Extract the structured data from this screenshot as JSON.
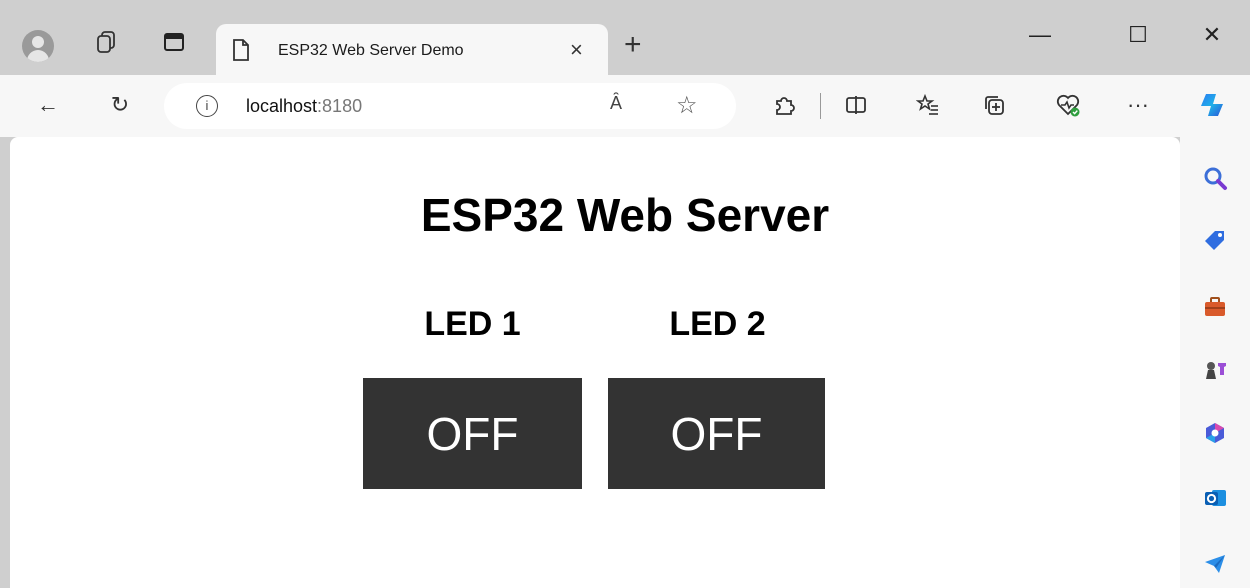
{
  "tab": {
    "title": "ESP32 Web Server Demo",
    "close": "×",
    "new_tab": "+"
  },
  "window": {
    "minimize": "—",
    "maximize": "☐",
    "close": "✕"
  },
  "address_bar": {
    "host": "localhost",
    "port": ":8180",
    "info": "i",
    "read_aloud": "Ȃ",
    "favorite": "☆"
  },
  "toolbar": {
    "back": "←",
    "reload": "↻",
    "more": "···"
  },
  "page": {
    "title": "ESP32 Web Server",
    "leds": [
      {
        "label": "LED 1",
        "state": "OFF"
      },
      {
        "label": "LED 2",
        "state": "OFF"
      }
    ]
  },
  "colors": {
    "button_bg": "#333333",
    "button_text": "#ffffff",
    "chrome": "#cfcfcf",
    "toolbar": "#f7f7f7"
  }
}
